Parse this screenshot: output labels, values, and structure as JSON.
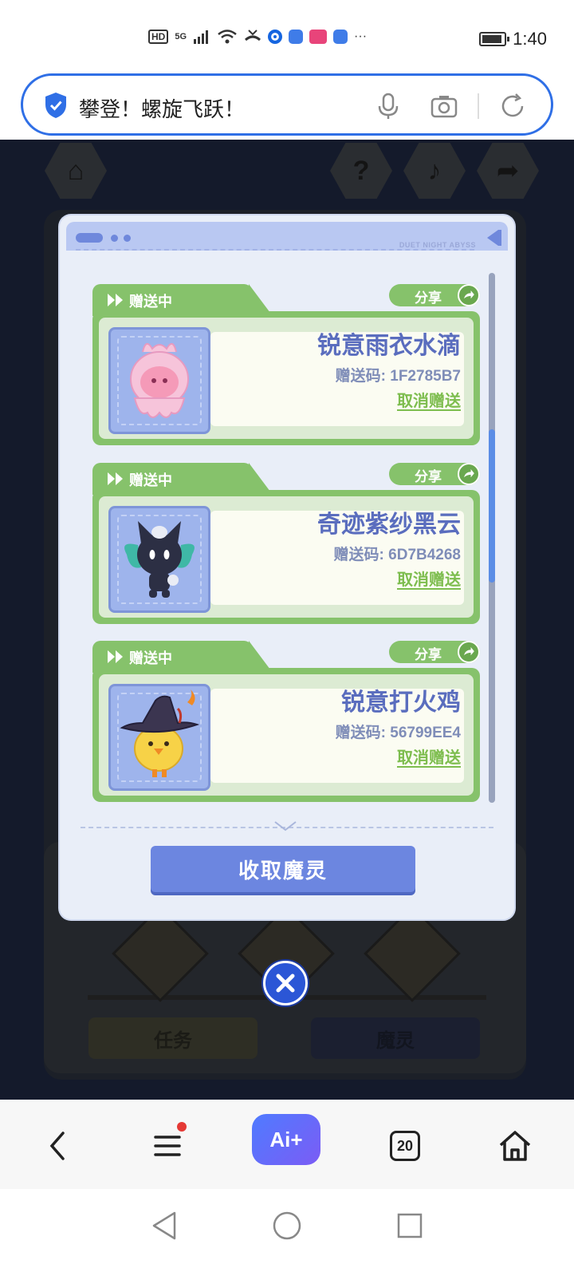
{
  "status_bar": {
    "hd": "HD",
    "network": "5G",
    "time": "1:40",
    "more": "···",
    "colors": {
      "icon": "#333333"
    }
  },
  "address_bar": {
    "title": "攀登！螺旋飞跃！",
    "accent_color": "#2f6fe6"
  },
  "dialog": {
    "header_brand": "DUET NIGHT ABYSS",
    "cards": [
      {
        "status": "赠送中",
        "share": "分享",
        "name": "锐意雨衣水滴",
        "code": "赠送码: 1F2785B7",
        "cancel": "取消赠送",
        "creature_icon": "pink-raincoat-drop-icon"
      },
      {
        "status": "赠送中",
        "share": "分享",
        "name": "奇迹紫纱黑云",
        "code": "赠送码: 6D7B4268",
        "cancel": "取消赠送",
        "creature_icon": "black-cloud-creature-icon"
      },
      {
        "status": "赠送中",
        "share": "分享",
        "name": "锐意打火鸡",
        "code": "赠送码: 56799EE4",
        "cancel": "取消赠送",
        "creature_icon": "witch-hat-chick-icon"
      }
    ],
    "collect_button": "收取魔灵",
    "colors": {
      "card_green": "#86c26b",
      "name_blue": "#5a6dbe",
      "button_blue": "#6c86e0"
    }
  },
  "background_ui": {
    "task_button": "任务",
    "spirit_button": "魔灵"
  },
  "browser_nav": {
    "ai_label": "Ai+",
    "tab_count": "20"
  }
}
